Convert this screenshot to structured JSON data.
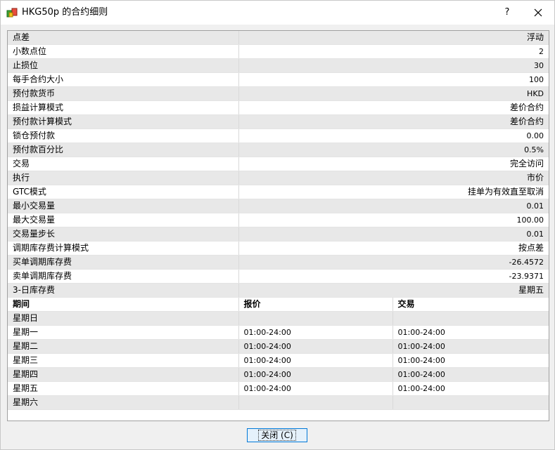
{
  "window": {
    "title": "HKG50p 的合约细则",
    "help_label": "?",
    "close_label": "✕"
  },
  "spec": [
    {
      "label": "点差",
      "value": "浮动"
    },
    {
      "label": "小数点位",
      "value": "2"
    },
    {
      "label": "止损位",
      "value": "30"
    },
    {
      "label": "每手合约大小",
      "value": "100"
    },
    {
      "label": "预付款货币",
      "value": "HKD"
    },
    {
      "label": "损益计算模式",
      "value": "差价合约"
    },
    {
      "label": "预付款计算模式",
      "value": "差价合约"
    },
    {
      "label": "锁仓预付款",
      "value": "0.00"
    },
    {
      "label": "预付款百分比",
      "value": "0.5%"
    },
    {
      "label": "交易",
      "value": "完全访问"
    },
    {
      "label": "执行",
      "value": "市价"
    },
    {
      "label": "GTC模式",
      "value": "挂单为有效直至取消"
    },
    {
      "label": "最小交易量",
      "value": "0.01"
    },
    {
      "label": "最大交易量",
      "value": "100.00"
    },
    {
      "label": "交易量步长",
      "value": "0.01"
    },
    {
      "label": "调期库存费计算模式",
      "value": "按点差"
    },
    {
      "label": "买单调期库存费",
      "value": "-26.4572"
    },
    {
      "label": "卖单调期库存费",
      "value": "-23.9371"
    },
    {
      "label": "3-日库存费",
      "value": "星期五"
    }
  ],
  "sessions": {
    "headers": [
      "期间",
      "报价",
      "交易"
    ],
    "rows": [
      {
        "day": "星期日",
        "quote": "",
        "trade": ""
      },
      {
        "day": "星期一",
        "quote": "01:00-24:00",
        "trade": "01:00-24:00"
      },
      {
        "day": "星期二",
        "quote": "01:00-24:00",
        "trade": "01:00-24:00"
      },
      {
        "day": "星期三",
        "quote": "01:00-24:00",
        "trade": "01:00-24:00"
      },
      {
        "day": "星期四",
        "quote": "01:00-24:00",
        "trade": "01:00-24:00"
      },
      {
        "day": "星期五",
        "quote": "01:00-24:00",
        "trade": "01:00-24:00"
      },
      {
        "day": "星期六",
        "quote": "",
        "trade": ""
      }
    ]
  },
  "footer": {
    "close_button": "关闭 (C)"
  },
  "colors": {
    "row_shade": "#e8e8e8",
    "button_border": "#0078d7",
    "button_fill": "#e5f1fb"
  }
}
